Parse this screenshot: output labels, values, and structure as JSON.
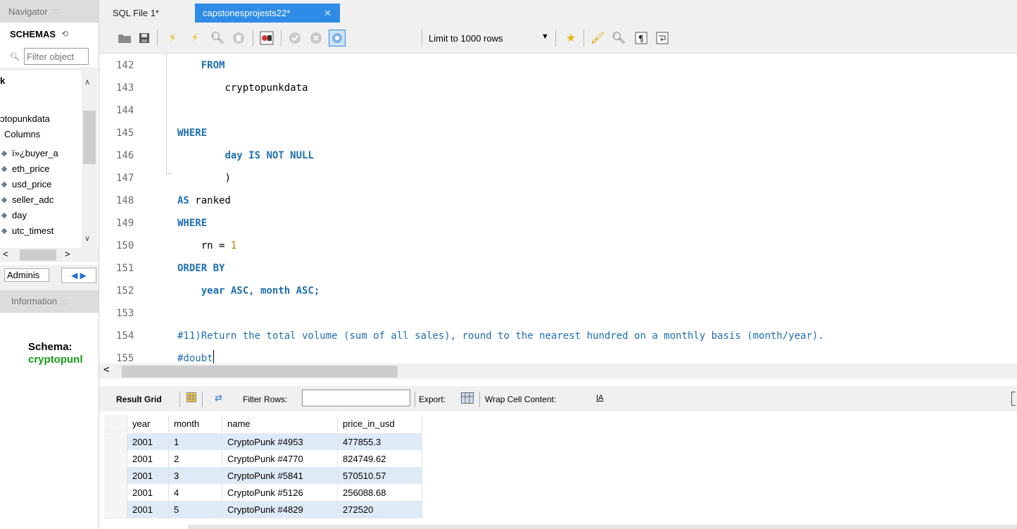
{
  "sidebar": {
    "navigator_label": "Navigator",
    "schemas_label": "SCHEMAS",
    "filter_placeholder": "Filter object",
    "tree": {
      "schema_name": "k",
      "table_name": "ɔtopunkdata",
      "columns_label": "Columns",
      "columns": [
        "ï»¿buyer_a",
        "eth_price",
        "usd_price",
        "seller_adc",
        "day",
        "utc_timest"
      ]
    },
    "admin_label": "Adminis",
    "information_label": "Information",
    "info_schema_key": "Schema:",
    "info_schema_value": "cryptopunl"
  },
  "tabs": [
    {
      "label": "SQL File 1*"
    },
    {
      "label": "capstonesprojests22*",
      "active": true
    }
  ],
  "toolbar": {
    "limit_label": "Limit to 1000 rows",
    "icons": [
      "folder-open-icon",
      "save-icon",
      "execute-icon",
      "execute-current-icon",
      "explain-icon",
      "stop-icon",
      "toggle-error-icon",
      "commit-icon",
      "rollback-icon",
      "autocommit-icon",
      "add-snippet-icon",
      "beautify-icon",
      "find-icon",
      "invisibles-icon",
      "wrap-icon"
    ]
  },
  "editor": {
    "lines": [
      {
        "n": "142",
        "indent": "    ",
        "parts": [
          {
            "t": "FROM",
            "c": "kw"
          }
        ]
      },
      {
        "n": "143",
        "indent": "        ",
        "parts": [
          {
            "t": "cryptopunkdata",
            "c": ""
          }
        ]
      },
      {
        "n": "144",
        "indent": "",
        "parts": []
      },
      {
        "n": "145",
        "indent": "",
        "parts": [
          {
            "t": "WHERE",
            "c": "kw"
          }
        ]
      },
      {
        "n": "146",
        "indent": "        ",
        "parts": [
          {
            "t": "day IS NOT NULL",
            "c": "kw"
          }
        ]
      },
      {
        "n": "147",
        "indent": "        ",
        "parts": [
          {
            "t": ")",
            "c": ""
          }
        ]
      },
      {
        "n": "148",
        "indent": "",
        "parts": [
          {
            "t": "AS",
            "c": "kw"
          },
          {
            "t": " ranked",
            "c": ""
          }
        ]
      },
      {
        "n": "149",
        "indent": "",
        "parts": [
          {
            "t": "WHERE",
            "c": "kw"
          }
        ]
      },
      {
        "n": "150",
        "indent": "    ",
        "parts": [
          {
            "t": "rn = ",
            "c": ""
          },
          {
            "t": "1",
            "c": "num"
          }
        ]
      },
      {
        "n": "151",
        "indent": "",
        "parts": [
          {
            "t": "ORDER BY",
            "c": "kw"
          }
        ]
      },
      {
        "n": "152",
        "indent": "    ",
        "parts": [
          {
            "t": "year ASC, month ASC;",
            "c": "kw"
          }
        ]
      },
      {
        "n": "153",
        "indent": "",
        "parts": []
      },
      {
        "n": "154",
        "indent": "",
        "parts": [
          {
            "t": "#11)Return the total volume (sum of all sales), round to the nearest hundred on a monthly basis (month/year).",
            "c": "cmt"
          }
        ]
      },
      {
        "n": "155",
        "indent": "",
        "parts": [
          {
            "t": "#doubt",
            "c": "cmt"
          }
        ],
        "caret": true
      }
    ]
  },
  "result": {
    "result_grid_label": "Result Grid",
    "filter_rows_label": "Filter Rows:",
    "export_label": "Export:",
    "wrap_label": "Wrap Cell Content:",
    "columns": [
      "year",
      "month",
      "name",
      "price_in_usd"
    ],
    "rows": [
      [
        "2001",
        "1",
        "CryptoPunk #4953",
        "477855.3"
      ],
      [
        "2001",
        "2",
        "CryptoPunk #4770",
        "824749.62"
      ],
      [
        "2001",
        "3",
        "CryptoPunk #5841",
        "570510.57"
      ],
      [
        "2001",
        "4",
        "CryptoPunk #5126",
        "256088.68"
      ],
      [
        "2001",
        "5",
        "CryptoPunk #4829",
        "272520"
      ]
    ]
  },
  "colors": {
    "active_tab": "#2e8ce6",
    "keyword": "#1f6fb2",
    "number": "#cc7700",
    "schema_value": "#1a9b1a",
    "row_highlight": "#dfeaf7"
  }
}
